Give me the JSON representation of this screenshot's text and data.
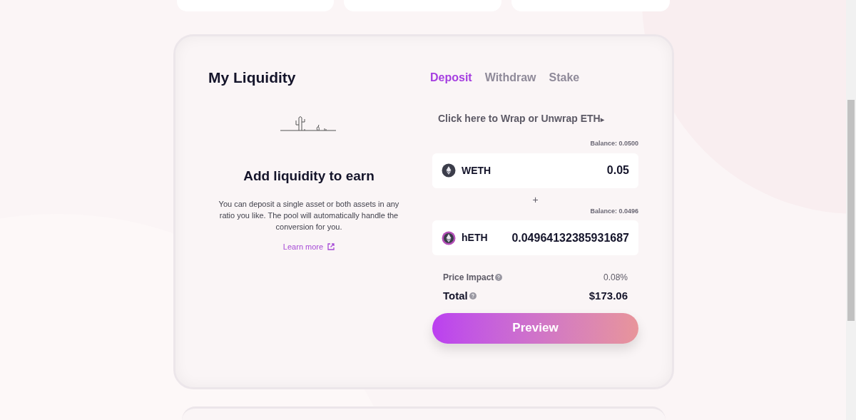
{
  "title": "My Liquidity",
  "tabs": [
    {
      "label": "Deposit",
      "selected": true
    },
    {
      "label": "Withdraw",
      "selected": false
    },
    {
      "label": "Stake",
      "selected": false
    }
  ],
  "empty_state": {
    "heading": "Add liquidity to earn",
    "text": "You can deposit a single asset or both assets in any ratio you like. The pool will automatically handle the conversion for you.",
    "link": "Learn more"
  },
  "wrap_link": "Click here to Wrap or Unwrap ETH",
  "wrap_arrow": "▸",
  "inputs": [
    {
      "balance": "Balance: 0.0500",
      "token": "WETH",
      "kind": "dark",
      "value": "0.05"
    },
    {
      "balance": "Balance: 0.0496",
      "token": "hETH",
      "kind": "ring",
      "value": "0.04964132385931687"
    }
  ],
  "separator": "+",
  "summary": [
    {
      "label": "Price Impact",
      "value": "0.08%",
      "kind": "minor"
    },
    {
      "label": "Total",
      "value": "$173.06",
      "kind": "major"
    }
  ],
  "button": "Preview"
}
